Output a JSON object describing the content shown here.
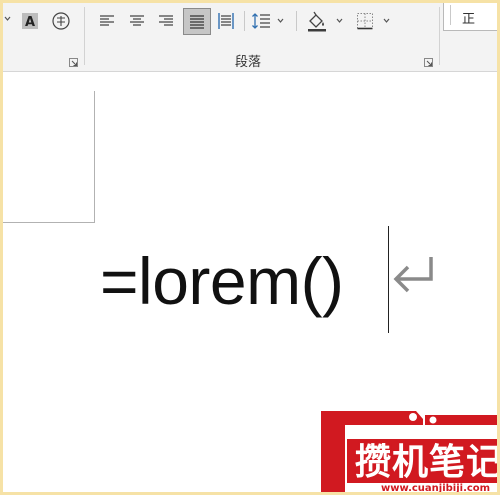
{
  "ribbon": {
    "paragraph_group_label": "段落",
    "style_preview_label": "正",
    "icons": {
      "shading_letter": "character-shading-icon",
      "enclose": "enclose-characters-icon",
      "align_left": "align-left-icon",
      "align_center": "align-center-icon",
      "align_right": "align-right-icon",
      "justify": "justify-icon",
      "distributed": "distributed-align-icon",
      "line_spacing": "line-spacing-icon",
      "shading": "paint-bucket-icon",
      "borders": "borders-icon",
      "launcher": "dialog-launcher-icon"
    }
  },
  "document": {
    "text": "=lorem()"
  },
  "watermark": {
    "title": "攒机笔记",
    "url": "www.cuanjibiji.com"
  },
  "colors": {
    "page_frame": "#f6e2a6",
    "ribbon_bg": "#f3f3f3",
    "active_button": "#c6c6c6",
    "icon_blue": "#2f6fb0",
    "watermark_red": "#d11920"
  }
}
